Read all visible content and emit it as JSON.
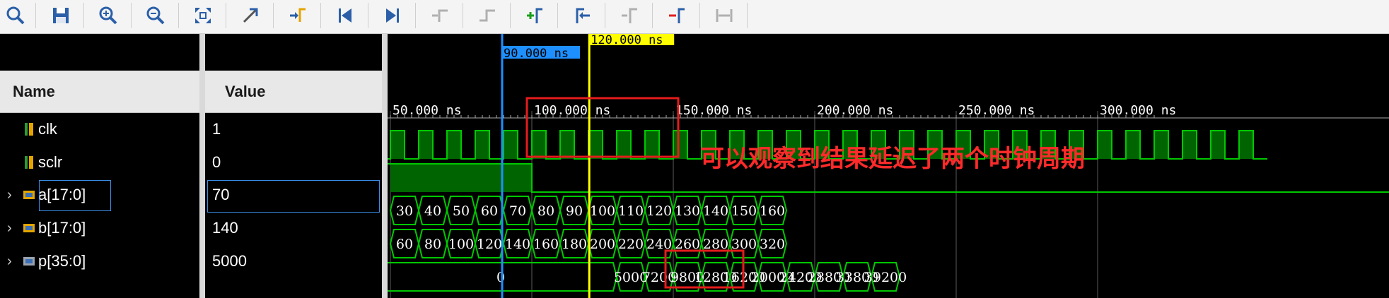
{
  "toolbar": {
    "icons": [
      "search-icon",
      "save-icon",
      "zoom-in-icon",
      "zoom-out-icon",
      "zoom-fit-icon",
      "cursor-snap-icon",
      "go-to-time-icon",
      "go-to-start-icon",
      "go-to-end-icon",
      "previous-transition-icon",
      "next-transition-icon",
      "add-marker-icon",
      "previous-marker-icon",
      "next-marker-icon",
      "swap-cursors-icon",
      "measure-icon"
    ]
  },
  "columns": {
    "name": "Name",
    "value": "Value"
  },
  "signals": [
    {
      "name": "clk",
      "value": "1",
      "kind": "bit",
      "expandable": false
    },
    {
      "name": "sclr",
      "value": "0",
      "kind": "bit",
      "expandable": false
    },
    {
      "name": "a[17:0]",
      "value": "70",
      "kind": "bus",
      "expandable": true
    },
    {
      "name": "b[17:0]",
      "value": "140",
      "kind": "bus",
      "expandable": true
    },
    {
      "name": "p[35:0]",
      "value": "5000",
      "kind": "bus",
      "expandable": true
    }
  ],
  "markers": {
    "blue": {
      "label": "90.000 ns",
      "time_ns": 90,
      "color": "#1e8fff"
    },
    "yellow": {
      "label": "120.000 ns",
      "time_ns": 120,
      "color": "#ffff00"
    }
  },
  "timeline": {
    "ticks": [
      "50.000 ns",
      "100.000 ns",
      "150.000 ns",
      "200.000 ns",
      "250.000 ns",
      "300.000 ns"
    ],
    "tick_times_ns": [
      50,
      100,
      150,
      200,
      250,
      300
    ],
    "view_start_ns": 50,
    "clk_period_ns": 10
  },
  "buses": {
    "a": [
      "30",
      "40",
      "50",
      "60",
      "70",
      "80",
      "90",
      "100",
      "110",
      "120",
      "130",
      "140",
      "150",
      "160"
    ],
    "b": [
      "60",
      "80",
      "100",
      "120",
      "140",
      "160",
      "180",
      "200",
      "220",
      "240",
      "260",
      "280",
      "300",
      "320"
    ],
    "p": [
      "0",
      "5000",
      "7200",
      "9800",
      "12800",
      "16200",
      "20000",
      "24200",
      "28800",
      "33800",
      "39200"
    ]
  },
  "annotation": {
    "text": "可以观察到结果延迟了两个时钟周期",
    "color": "#ff2a2a"
  },
  "colors": {
    "wave": "#00c800",
    "wave_fill": "#006400",
    "grid": "#5a5a5a"
  }
}
